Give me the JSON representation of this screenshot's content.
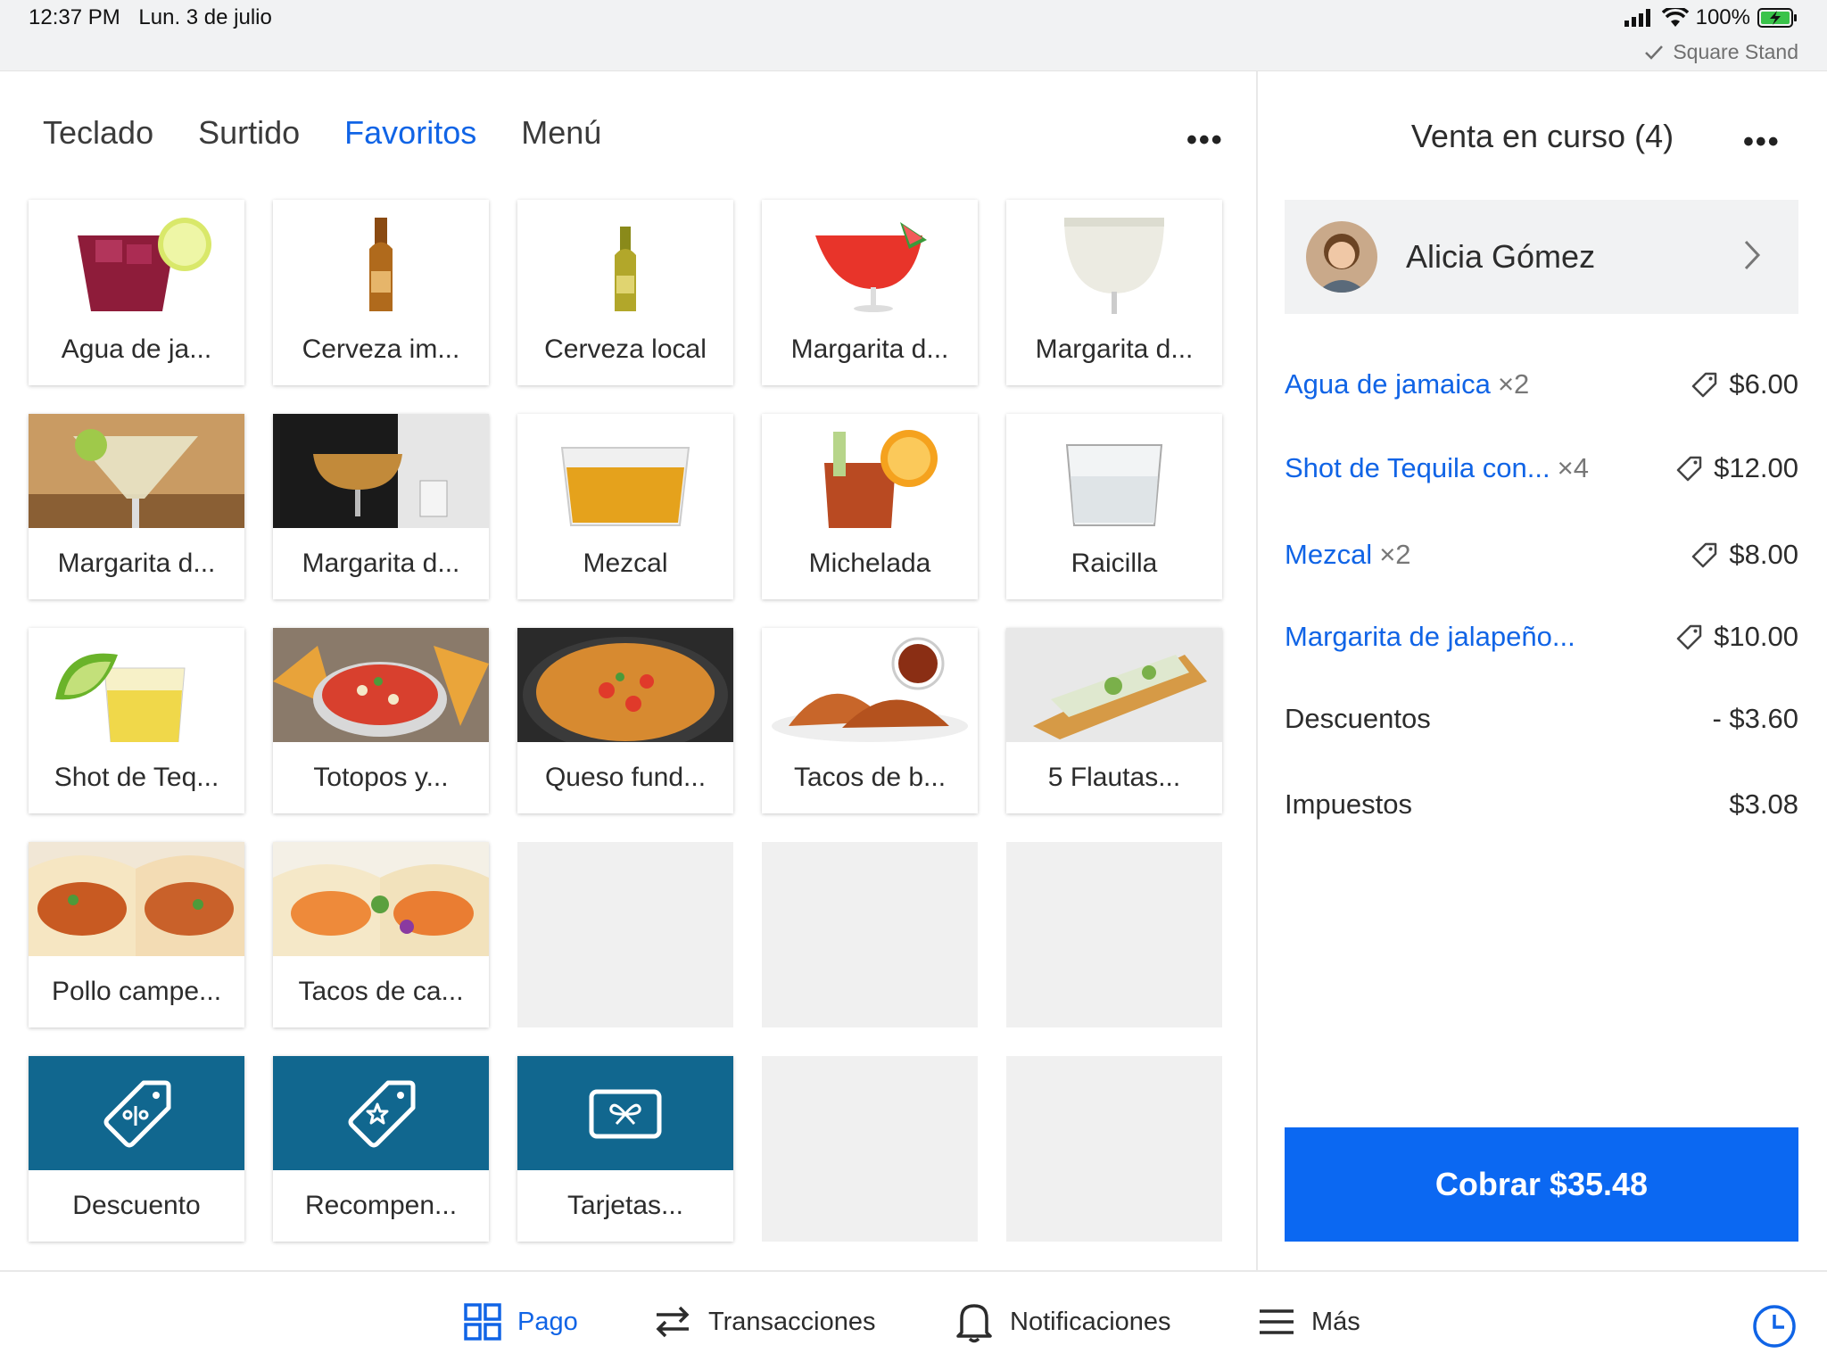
{
  "status_bar": {
    "time": "12:37 PM",
    "date": "Lun. 3 de julio",
    "battery": "100%",
    "device": "Square Stand"
  },
  "tabs": [
    "Teclado",
    "Surtido",
    "Favoritos",
    "Menú"
  ],
  "active_tab": "Favoritos",
  "items": [
    {
      "label": "Agua de ja...",
      "image": "agua-de-jamaica-image"
    },
    {
      "label": "Cerveza im...",
      "image": "cerveza-importada-image"
    },
    {
      "label": "Cerveza local",
      "image": "cerveza-local-image"
    },
    {
      "label": "Margarita d...",
      "image": "margarita-fresa-image"
    },
    {
      "label": "Margarita d...",
      "image": "margarita-coco-image"
    },
    {
      "label": "Margarita d...",
      "image": "margarita-clasica-image"
    },
    {
      "label": "Margarita d...",
      "image": "margarita-ahumada-image"
    },
    {
      "label": "Mezcal",
      "image": "mezcal-image"
    },
    {
      "label": "Michelada",
      "image": "michelada-image"
    },
    {
      "label": "Raicilla",
      "image": "raicilla-image"
    },
    {
      "label": "Shot de Teq...",
      "image": "shot-tequila-image"
    },
    {
      "label": "Totopos y...",
      "image": "totopos-image"
    },
    {
      "label": "Queso fund...",
      "image": "queso-fundido-image"
    },
    {
      "label": "Tacos de b...",
      "image": "tacos-birria-image"
    },
    {
      "label": "5 Flautas...",
      "image": "flautas-image"
    },
    {
      "label": "Pollo campe...",
      "image": "pollo-campero-image"
    },
    {
      "label": "Tacos de ca...",
      "image": "tacos-camaron-image"
    }
  ],
  "actions": [
    {
      "label": "Descuento",
      "icon": "discount-tag-icon"
    },
    {
      "label": "Recompen...",
      "icon": "reward-tag-icon"
    },
    {
      "label": "Tarjetas...",
      "icon": "gift-card-icon"
    }
  ],
  "sale": {
    "title": "Venta en curso (4)",
    "customer": "Alicia Gómez",
    "lines": [
      {
        "name": "Agua de jamaica",
        "qty": "×2",
        "amount": "$6.00"
      },
      {
        "name": "Shot de Tequila con...",
        "qty": "×4",
        "amount": "$12.00"
      },
      {
        "name": "Mezcal",
        "qty": "×2",
        "amount": "$8.00"
      },
      {
        "name": "Margarita de jalapeño...",
        "qty": "",
        "amount": "$10.00"
      }
    ],
    "discounts_label": "Descuentos",
    "discounts_value": "- $3.60",
    "taxes_label": "Impuestos",
    "taxes_value": "$3.08",
    "charge_label": "Cobrar $35.48"
  },
  "bottom_nav": {
    "pago": "Pago",
    "transacciones": "Transacciones",
    "notificaciones": "Notificaciones",
    "mas": "Más"
  },
  "colors": {
    "accent": "#1064e6",
    "charge_button": "#0b68f2",
    "action_tile": "#11678f"
  }
}
